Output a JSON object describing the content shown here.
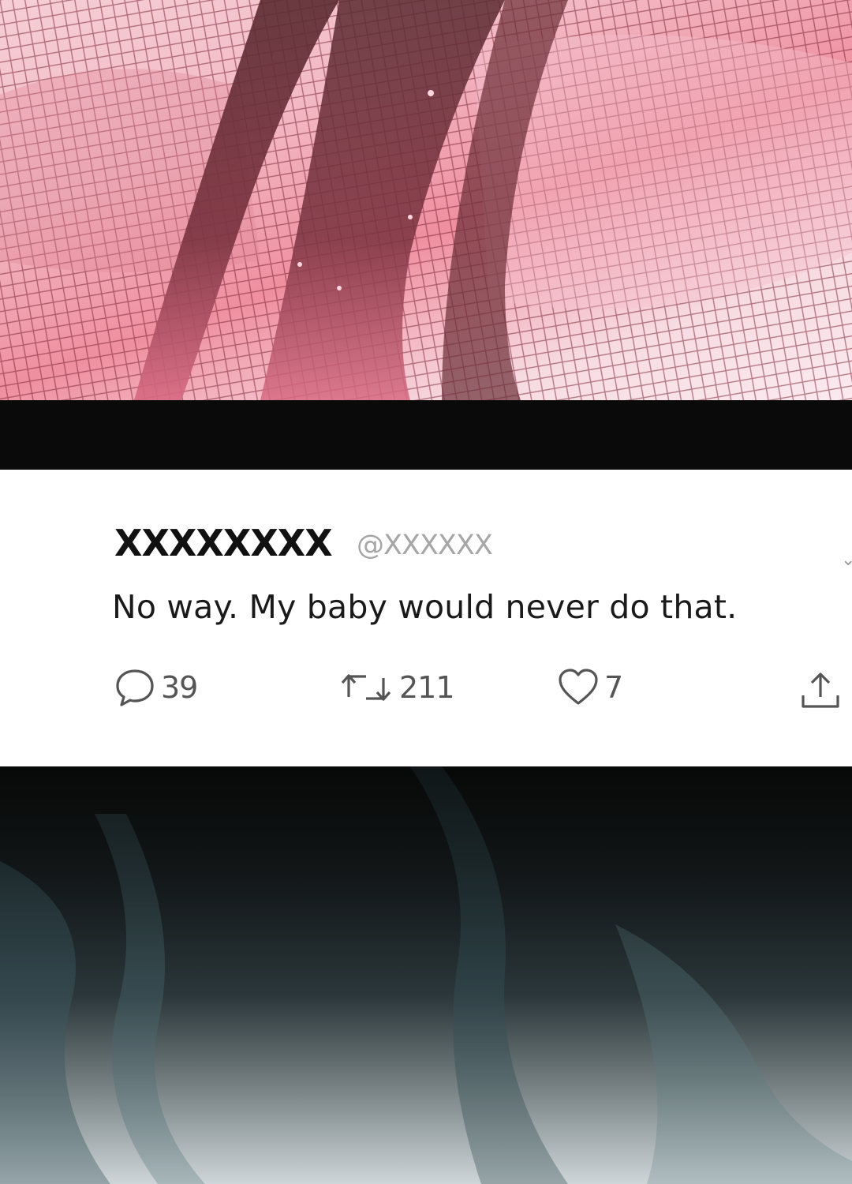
{
  "tweet": {
    "display_name": "XXXXXXXX",
    "handle": "@XXXXXX",
    "text": "No way. My baby would never do that.",
    "replies": "39",
    "retweets": "211",
    "likes": "7"
  },
  "icons": {
    "reply": "speech-bubble-icon",
    "retweet": "retweet-arrows-icon",
    "like": "heart-outline-icon",
    "share": "share-upload-icon",
    "more": "chevron-down-icon"
  },
  "colors": {
    "card_bg": "#ffffff",
    "name": "#111111",
    "handle": "#a6a6a6",
    "icon": "#555555",
    "avatar": "#c8c8c8",
    "gap": "#0a0a0a"
  }
}
